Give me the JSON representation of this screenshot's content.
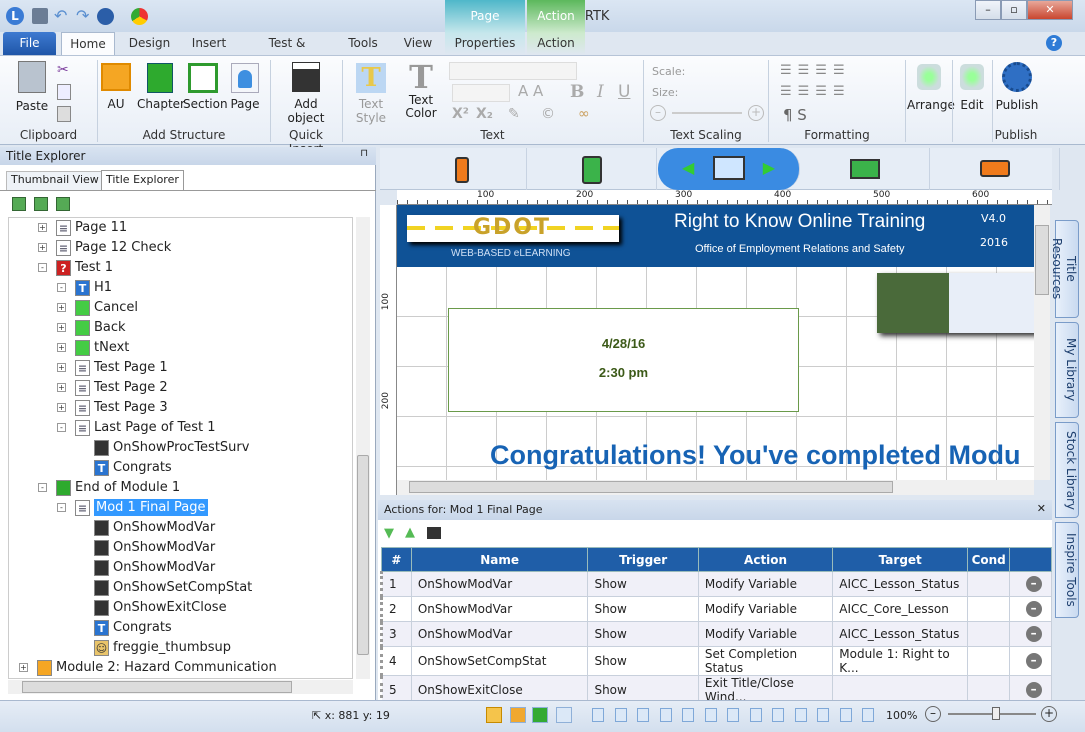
{
  "window": {
    "title": "Lectora Inspire - RTK",
    "context_tabs": [
      {
        "label": "Page",
        "color": "#3aa6b9"
      },
      {
        "label": "Action",
        "color": "#4caf50"
      }
    ]
  },
  "tabs": [
    "File",
    "Home",
    "Design",
    "Insert",
    "Test & Survey",
    "Tools",
    "View",
    "Properties",
    "Action"
  ],
  "ribbon": {
    "clipboard": {
      "paste": "Paste",
      "label": "Clipboard"
    },
    "structure": {
      "au": "AU",
      "chapter": "Chapter",
      "section": "Section",
      "page": "Page",
      "label": "Add Structure"
    },
    "quick": {
      "add_object": "Add object",
      "label": "Quick Insert"
    },
    "text": {
      "text_style": "Text Style",
      "text_color": "Text Color",
      "label": "Text"
    },
    "scaling": {
      "scale": "Scale:",
      "size": "Size:",
      "label": "Text Scaling"
    },
    "formatting": {
      "label": "Formatting"
    },
    "arrange": "Arrange",
    "edit": "Edit",
    "publish": "Publish",
    "publish_label": "Publish"
  },
  "left_panel": {
    "title": "Title Explorer",
    "tabs": [
      "Thumbnail View",
      "Title Explorer"
    ],
    "tree": [
      {
        "level": 1,
        "label": "Page 11",
        "icon": "page",
        "exp": "+"
      },
      {
        "level": 1,
        "label": "Page 12 Check",
        "icon": "page",
        "exp": "+"
      },
      {
        "level": 1,
        "label": "Test 1",
        "icon": "test",
        "exp": "-"
      },
      {
        "level": 2,
        "label": "H1",
        "icon": "text",
        "exp": "-"
      },
      {
        "level": 2,
        "label": "Cancel",
        "icon": "button",
        "exp": "+"
      },
      {
        "level": 2,
        "label": "Back",
        "icon": "button",
        "exp": "+"
      },
      {
        "level": 2,
        "label": "tNext",
        "icon": "button",
        "exp": "+"
      },
      {
        "level": 2,
        "label": "Test Page 1",
        "icon": "page",
        "exp": "+"
      },
      {
        "level": 2,
        "label": "Test Page 2",
        "icon": "page",
        "exp": "+"
      },
      {
        "level": 2,
        "label": "Test Page 3",
        "icon": "page",
        "exp": "+"
      },
      {
        "level": 2,
        "label": "Last Page of Test 1",
        "icon": "page",
        "exp": "-"
      },
      {
        "level": 3,
        "label": "OnShowProcTestSurv",
        "icon": "action",
        "exp": ""
      },
      {
        "level": 3,
        "label": "Congrats",
        "icon": "text",
        "exp": ""
      },
      {
        "level": 1,
        "label": "End of Module 1",
        "icon": "chapter",
        "exp": "-"
      },
      {
        "level": 2,
        "label": "Mod 1 Final Page",
        "icon": "page",
        "exp": "-",
        "selected": true
      },
      {
        "level": 3,
        "label": "OnShowModVar",
        "icon": "action",
        "exp": ""
      },
      {
        "level": 3,
        "label": "OnShowModVar",
        "icon": "action",
        "exp": ""
      },
      {
        "level": 3,
        "label": "OnShowModVar",
        "icon": "action",
        "exp": ""
      },
      {
        "level": 3,
        "label": "OnShowSetCompStat",
        "icon": "action",
        "exp": ""
      },
      {
        "level": 3,
        "label": "OnShowExitClose",
        "icon": "action",
        "exp": ""
      },
      {
        "level": 3,
        "label": "Congrats",
        "icon": "text",
        "exp": ""
      },
      {
        "level": 3,
        "label": "freggie_thumbsup",
        "icon": "image",
        "exp": ""
      },
      {
        "level": 0,
        "label": "Module 2: Hazard Communication",
        "icon": "au",
        "exp": "+"
      }
    ]
  },
  "ruler": [
    "100",
    "200",
    "300",
    "400",
    "500",
    "600"
  ],
  "vruler": [
    "100",
    "200"
  ],
  "page": {
    "logo": "GDOT",
    "logo_sub": "WEB-BASED eLEARNING",
    "title": "Right to Know Online Training",
    "subtitle": "Office of Employment Relations and Safety",
    "version": "V4.0",
    "year": "2016",
    "date": "4/28/16",
    "time": "2:30 pm",
    "congrats": "Congratulations! You've completed Modu"
  },
  "actions": {
    "title": "Actions for: Mod 1 Final Page",
    "columns": [
      "#",
      "Name",
      "Trigger",
      "Action",
      "Target",
      "Cond"
    ],
    "rows": [
      [
        "1",
        "OnShowModVar",
        "Show",
        "Modify Variable",
        "AICC_Lesson_Status",
        ""
      ],
      [
        "2",
        "OnShowModVar",
        "Show",
        "Modify Variable",
        "AICC_Core_Lesson",
        ""
      ],
      [
        "3",
        "OnShowModVar",
        "Show",
        "Modify Variable",
        "AICC_Lesson_Status",
        ""
      ],
      [
        "4",
        "OnShowSetCompStat",
        "Show",
        "Set Completion Status",
        "Module 1: Right to K...",
        ""
      ],
      [
        "5",
        "OnShowExitClose",
        "Show",
        "Exit Title/Close Wind...",
        "",
        ""
      ]
    ]
  },
  "side_tabs": [
    "Title Resources",
    "My Library",
    "Stock Library",
    "Inspire Tools"
  ],
  "status": {
    "coords": "x: 881  y: 19",
    "zoom": "100%",
    "zoom_level": 0.55
  }
}
